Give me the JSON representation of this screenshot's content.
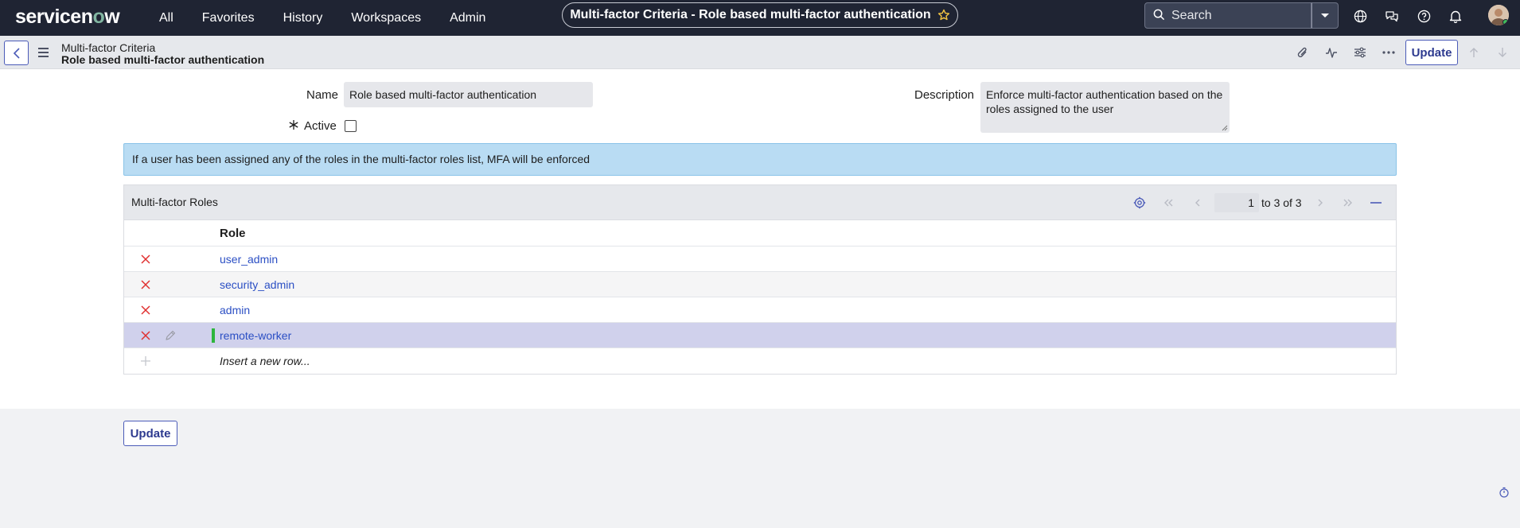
{
  "nav": {
    "logo_pre": "servicen",
    "logo_o": "o",
    "logo_post": "w",
    "menu": [
      "All",
      "Favorites",
      "History",
      "Workspaces",
      "Admin"
    ],
    "page_title": "Multi-factor Criteria - Role based multi-factor authentication",
    "search_placeholder": "Search"
  },
  "header": {
    "breadcrumb_table": "Multi-factor Criteria",
    "breadcrumb_record": "Role based multi-factor authentication",
    "update_label": "Update"
  },
  "form": {
    "name_label": "Name",
    "name_value": "Role based multi-factor authentication",
    "active_label": "Active",
    "active_checked": false,
    "description_label": "Description",
    "description_value": "Enforce multi-factor authentication based on the roles assigned to the user"
  },
  "info_message": "If a user has been assigned any of the roles in the multi-factor roles list, MFA will be enforced",
  "related_list": {
    "title": "Multi-factor Roles",
    "page_current": "1",
    "page_of": "to 3 of 3",
    "column_header": "Role",
    "rows": [
      "user_admin",
      "security_admin",
      "admin",
      "remote-worker"
    ],
    "insert_label": "Insert a new row..."
  },
  "footer": {
    "update_label": "Update"
  },
  "colors": {
    "nav_bg": "#1f2433",
    "accent": "#4b5bb8",
    "link": "#2b4fc4",
    "info_bg": "#b9dcf3",
    "selected_row": "#d0d1ec",
    "delete_red": "#e03030"
  }
}
